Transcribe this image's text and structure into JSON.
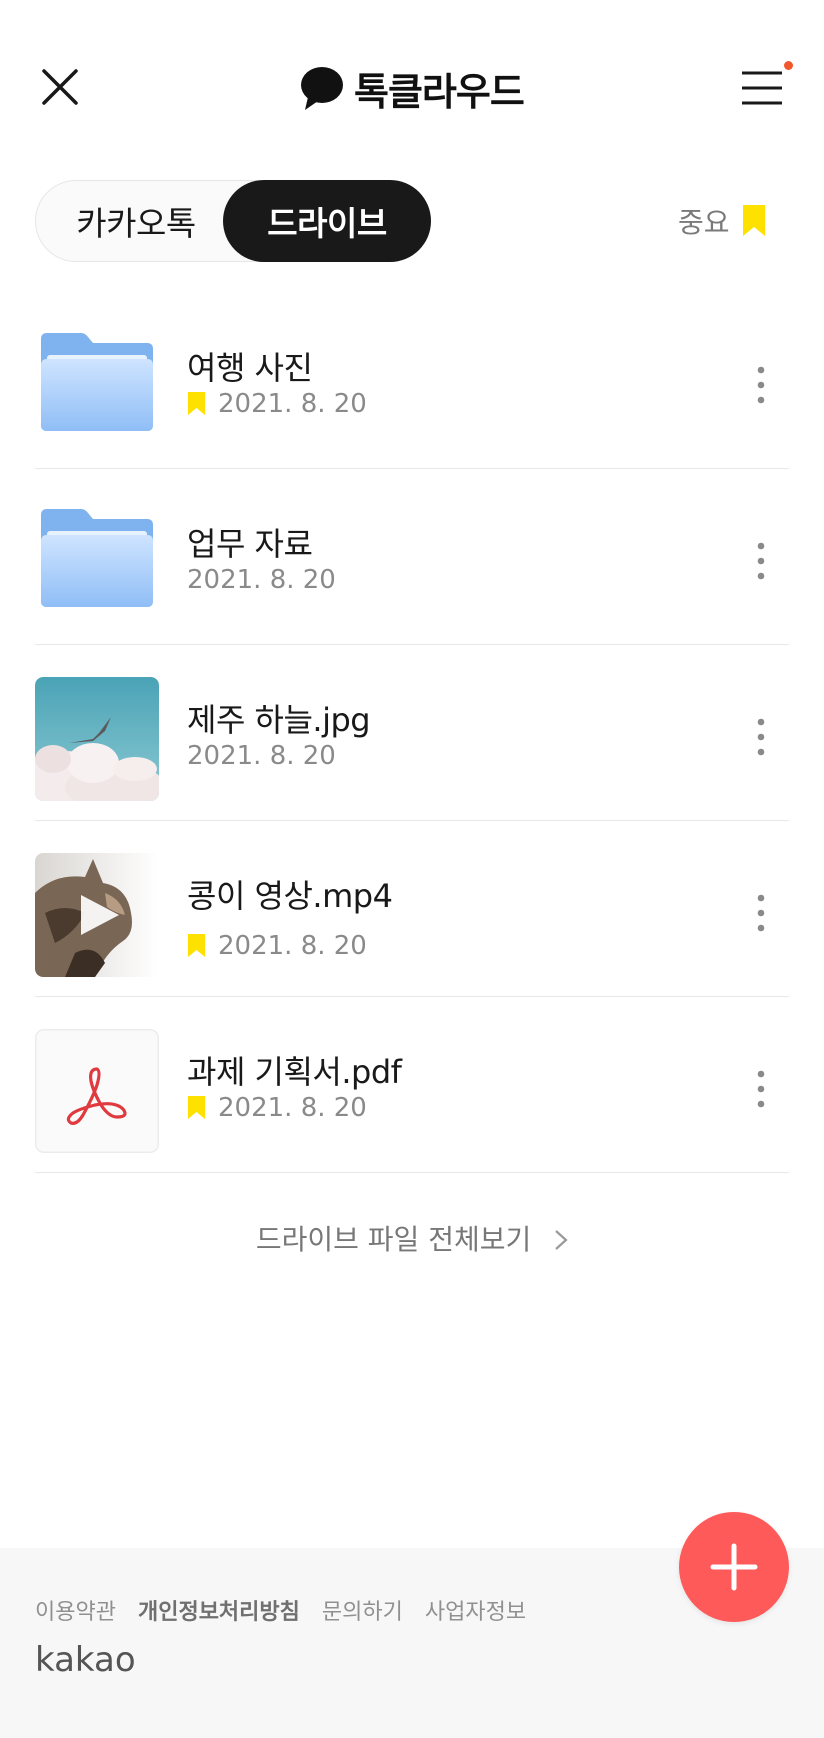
{
  "header": {
    "close_icon": "close-icon",
    "logo_icon": "chat-bubble-icon",
    "title": "톡클라우드",
    "menu_icon": "hamburger-menu-icon",
    "notification_color": "#f2582c"
  },
  "tabs": {
    "kakaotalk_label": "카카오톡",
    "drive_label": "드라이브",
    "selected": "드라이브"
  },
  "important": {
    "label": "중요",
    "icon": "bookmark-icon",
    "color": "#ffe100"
  },
  "files": [
    {
      "name": "여행 사진",
      "date": "2021. 8. 20",
      "bookmarked": true,
      "thumb": "folder-icon"
    },
    {
      "name": "업무 자료",
      "date": "2021. 8. 20",
      "bookmarked": false,
      "thumb": "folder-icon"
    },
    {
      "name": "제주 하늘.jpg",
      "date": "2021. 8. 20",
      "bookmarked": false,
      "thumb": "sky-photo"
    },
    {
      "name": "콩이 영상.mp4",
      "date": "2021. 8. 20",
      "bookmarked": true,
      "thumb": "cat-video"
    },
    {
      "name": "과제 기획서.pdf",
      "date": "2021. 8. 20",
      "bookmarked": true,
      "thumb": "pdf-icon"
    }
  ],
  "view_all": {
    "label": "드라이브 파일 전체보기"
  },
  "footer": {
    "links": [
      "이용약관",
      "개인정보처리방침",
      "문의하기",
      "사업자정보"
    ],
    "logo": "kakao"
  },
  "fab": {
    "icon": "plus-icon",
    "color": "#ff5a5a"
  }
}
